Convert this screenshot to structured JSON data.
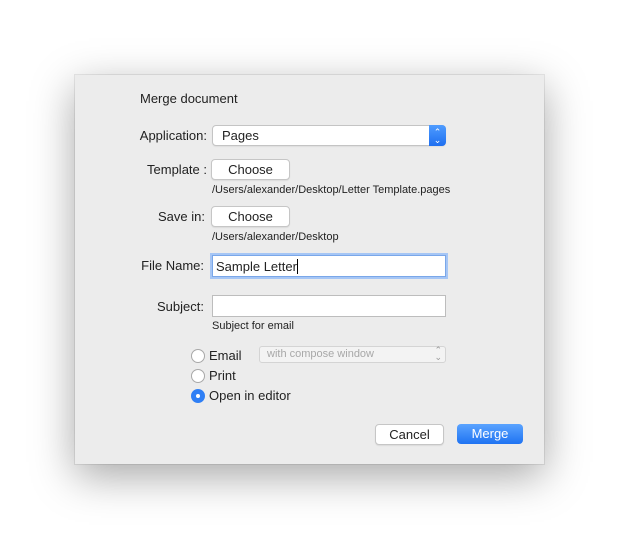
{
  "dialog": {
    "title": "Merge document",
    "application": {
      "label": "Application:",
      "value": "Pages"
    },
    "template": {
      "label": "Template :",
      "button": "Choose",
      "path": "/Users/alexander/Desktop/Letter Template.pages"
    },
    "save_in": {
      "label": "Save in:",
      "button": "Choose",
      "path": "/Users/alexander/Desktop"
    },
    "file_name": {
      "label": "File Name:",
      "value": "Sample Letter"
    },
    "subject": {
      "label": "Subject:",
      "value": "",
      "hint": "Subject for email"
    },
    "output_options": [
      {
        "label": "Email",
        "selected": false
      },
      {
        "label": "Print",
        "selected": false
      },
      {
        "label": "Open in editor",
        "selected": true
      }
    ],
    "email_mode": {
      "value": "with compose window",
      "enabled": false
    },
    "cancel_label": "Cancel",
    "merge_label": "Merge"
  },
  "colors": {
    "accent": "#2f7ff5",
    "dialog_bg": "#ececec"
  }
}
